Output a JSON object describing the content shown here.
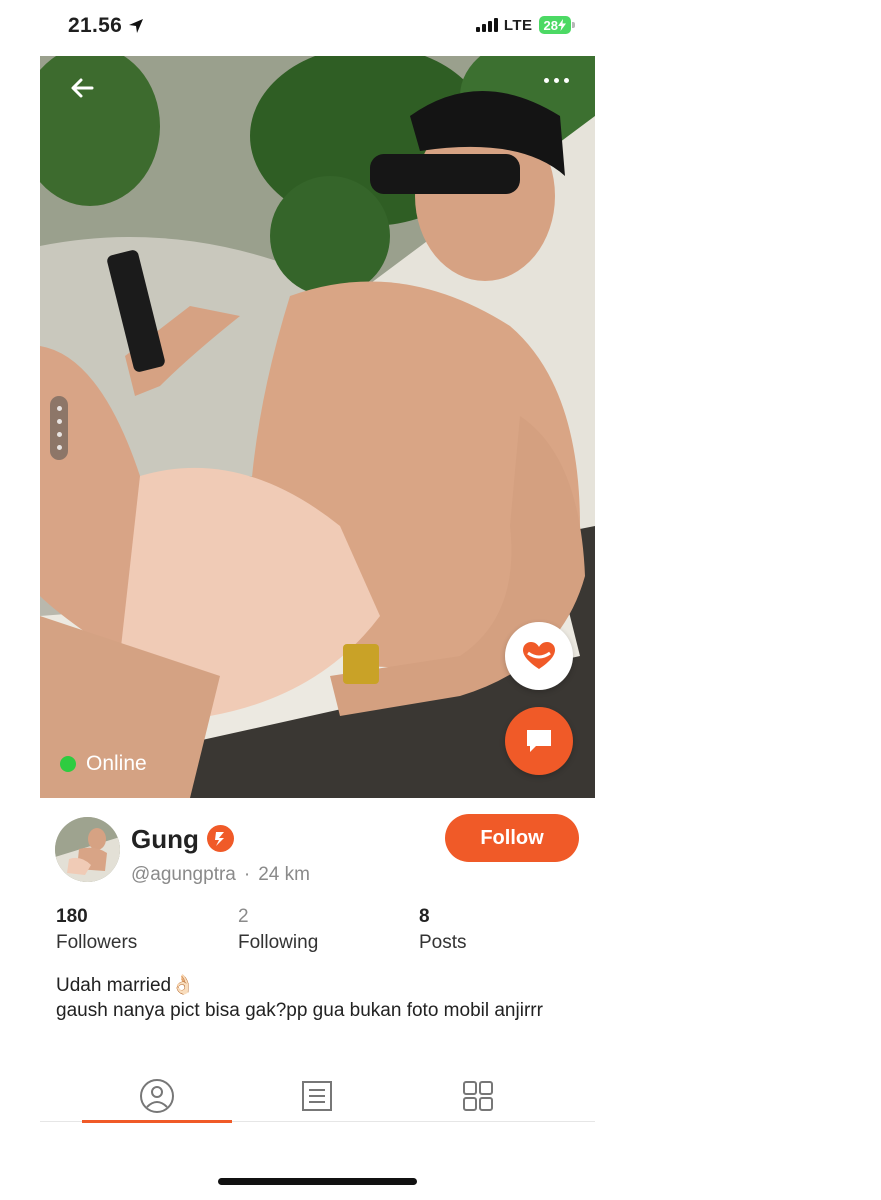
{
  "status_bar": {
    "time": "21.56",
    "network": "LTE",
    "battery": "28"
  },
  "photo": {
    "online_label": "Online"
  },
  "profile": {
    "name": "Gung",
    "handle": "@agungptra",
    "separator": "·",
    "distance": "24 km",
    "follow_label": "Follow"
  },
  "stats": [
    {
      "value": "180",
      "label": "Followers"
    },
    {
      "value": "2",
      "label": "Following"
    },
    {
      "value": "8",
      "label": "Posts"
    }
  ],
  "bio": {
    "line1": "Udah married👌🏻",
    "line2": "gaush nanya pict bisa gak?pp gua bukan foto mobil anjirrr"
  },
  "tabs": [
    {
      "icon": "profile-icon",
      "active": true
    },
    {
      "icon": "list-icon",
      "active": false
    },
    {
      "icon": "grid-icon",
      "active": false
    }
  ],
  "colors": {
    "accent": "#f05a28",
    "online": "#2ecc40",
    "battery": "#4cd964"
  }
}
